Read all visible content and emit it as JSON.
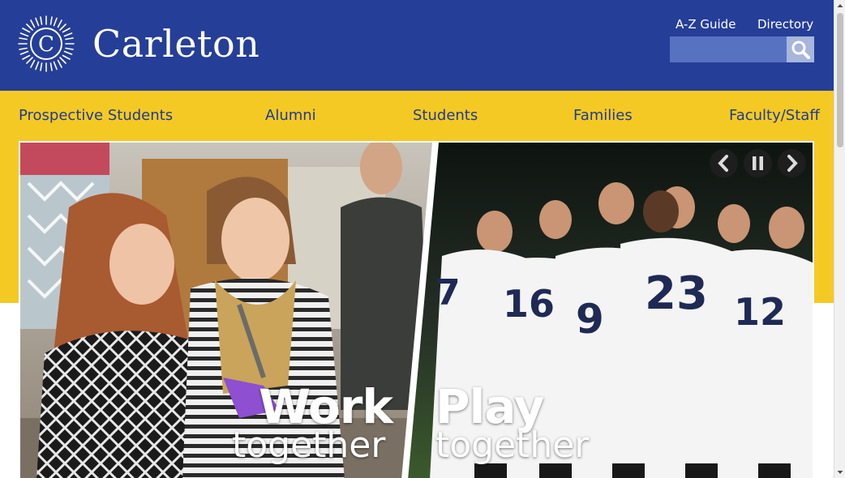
{
  "header": {
    "logo_text": "Carleton",
    "seal_letter": "C",
    "utility_links": [
      "A-Z Guide",
      "Directory"
    ],
    "search": {
      "placeholder": "",
      "value": ""
    }
  },
  "nav": {
    "items": [
      "Prospective Students",
      "Alumni",
      "Students",
      "Families",
      "Faculty/Staff"
    ]
  },
  "hero": {
    "left_caption": {
      "big": "Work",
      "small": "together"
    },
    "right_caption": {
      "big": "Play",
      "small": "together"
    },
    "jersey_numbers": [
      "16",
      "23",
      "9",
      "12",
      "7"
    ]
  },
  "colors": {
    "header_blue": "#253e97",
    "nav_gold": "#f5c924",
    "nav_text": "#1f3c8f",
    "search_field": "#5872c2",
    "search_button": "#a8b5dc"
  },
  "icons": {
    "seal": "sunburst-seal-icon",
    "search": "magnifier-icon",
    "prev": "chevron-left-icon",
    "pause": "pause-icon",
    "next": "chevron-right-icon"
  }
}
